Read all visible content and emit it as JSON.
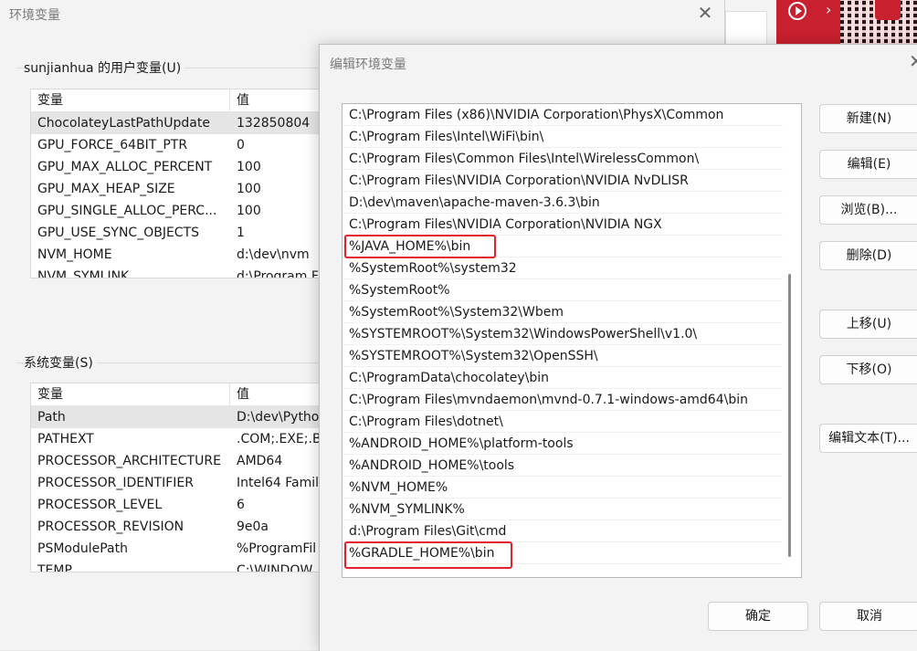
{
  "bg_window": {
    "title": "环境变量",
    "close_glyph": "✕",
    "user_section": {
      "title": "sunjianhua 的用户变量(U)",
      "headers": [
        "变量",
        "值"
      ],
      "rows": [
        [
          "ChocolateyLastPathUpdate",
          "132850804"
        ],
        [
          "GPU_FORCE_64BIT_PTR",
          "0"
        ],
        [
          "GPU_MAX_ALLOC_PERCENT",
          "100"
        ],
        [
          "GPU_MAX_HEAP_SIZE",
          "100"
        ],
        [
          "GPU_SINGLE_ALLOC_PERC...",
          "100"
        ],
        [
          "GPU_USE_SYNC_OBJECTS",
          "1"
        ],
        [
          "NVM_HOME",
          "d:\\dev\\nvm"
        ],
        [
          "NVM_SYMLINK",
          "d:\\Program F"
        ]
      ]
    },
    "system_section": {
      "title": "系统变量(S)",
      "headers": [
        "变量",
        "值"
      ],
      "rows": [
        [
          "Path",
          "D:\\dev\\Pytho"
        ],
        [
          "PATHEXT",
          ".COM;.EXE;.B"
        ],
        [
          "PROCESSOR_ARCHITECTURE",
          "AMD64"
        ],
        [
          "PROCESSOR_IDENTIFIER",
          "Intel64 Famil"
        ],
        [
          "PROCESSOR_LEVEL",
          "6"
        ],
        [
          "PROCESSOR_REVISION",
          "9e0a"
        ],
        [
          "PSModulePath",
          "%ProgramFil"
        ],
        [
          "TEMP",
          "C:\\WINDOW"
        ]
      ]
    }
  },
  "dialog": {
    "title": "编辑环境变量",
    "close_glyph": "✕",
    "path_entries": [
      "C:\\Program Files (x86)\\NVIDIA Corporation\\PhysX\\Common",
      "C:\\Program Files\\Intel\\WiFi\\bin\\",
      "C:\\Program Files\\Common Files\\Intel\\WirelessCommon\\",
      "C:\\Program Files\\NVIDIA Corporation\\NVIDIA NvDLISR",
      "D:\\dev\\maven\\apache-maven-3.6.3\\bin",
      "C:\\Program Files\\NVIDIA Corporation\\NVIDIA NGX",
      "%JAVA_HOME%\\bin",
      "%SystemRoot%\\system32",
      "%SystemRoot%",
      "%SystemRoot%\\System32\\Wbem",
      "%SYSTEMROOT%\\System32\\WindowsPowerShell\\v1.0\\",
      "%SYSTEMROOT%\\System32\\OpenSSH\\",
      "C:\\ProgramData\\chocolatey\\bin",
      "C:\\Program Files\\mvndaemon\\mvnd-0.7.1-windows-amd64\\bin",
      "C:\\Program Files\\dotnet\\",
      "%ANDROID_HOME%\\platform-tools",
      "%ANDROID_HOME%\\tools",
      "%NVM_HOME%",
      "%NVM_SYMLINK%",
      "d:\\Program Files\\Git\\cmd",
      "%GRADLE_HOME%\\bin"
    ],
    "buttons": {
      "new": "新建(N)",
      "edit": "编辑(E)",
      "browse": "浏览(B)...",
      "delete": "删除(D)",
      "move_up": "上移(U)",
      "move_down": "下移(O)",
      "edit_text": "编辑文本(T)...",
      "ok": "确定",
      "cancel": "取消"
    }
  },
  "colors": {
    "highlight_red": "#e3212b",
    "ad_red": "#c8202e"
  },
  "icons": [
    "close-icon",
    "play-icon",
    "qr-code-icon"
  ]
}
